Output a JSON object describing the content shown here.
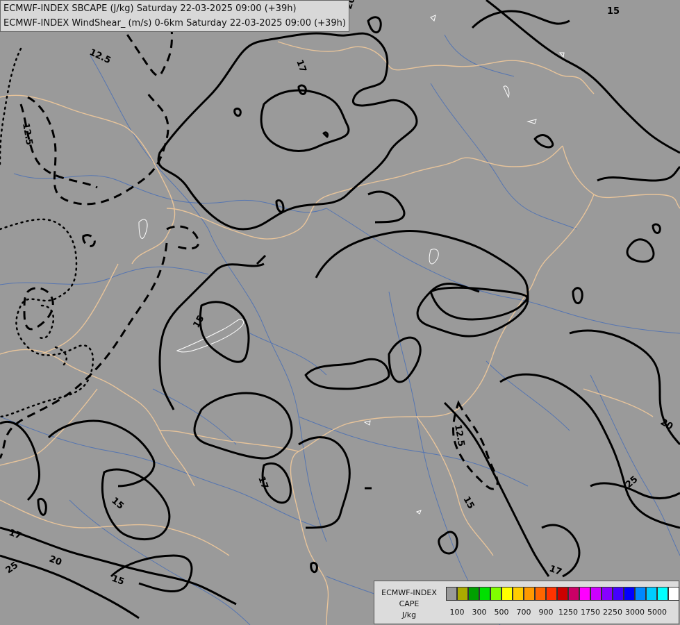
{
  "header": {
    "line1": "ECMWF-INDEX SBCAPE (J/kg) Saturday 22-03-2025 09:00 (+39h)",
    "line2": "ECMWF-INDEX WindShear_ (m/s) 0-6km Saturday 22-03-2025 09:00 (+39h)"
  },
  "contour_labels": [
    "20",
    "15",
    "12.5",
    "17",
    "12.5",
    "17",
    "15",
    "12.5",
    "15",
    "17",
    "15",
    "17",
    "20",
    "25",
    "15",
    "20",
    "25",
    "15",
    "17"
  ],
  "legend": {
    "title_line1": "ECMWF-INDEX",
    "title_line2": "CAPE",
    "title_line3": "J/kg",
    "colors": [
      "#9a9a9a",
      "#aaaa00",
      "#00a000",
      "#00e000",
      "#80ff00",
      "#ffff00",
      "#ffcc00",
      "#ff9900",
      "#ff6600",
      "#ff3300",
      "#cc0000",
      "#cc0066",
      "#ff00ff",
      "#cc00ff",
      "#8800ff",
      "#4400ff",
      "#0000ff",
      "#0088ff",
      "#00ccff",
      "#00ffff",
      "#ffffff"
    ],
    "tick_labels": [
      "100",
      "300",
      "500",
      "700",
      "900",
      "1250",
      "1750",
      "2250",
      "3000",
      "5000"
    ]
  }
}
